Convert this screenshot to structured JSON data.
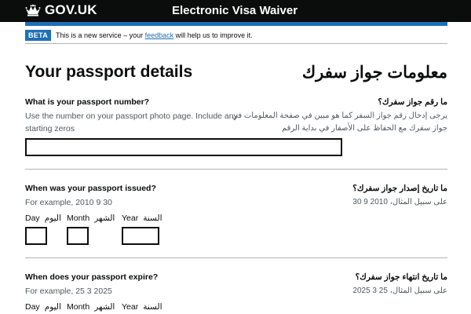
{
  "header": {
    "logo_text": "GOV.UK",
    "service_name": "Electronic Visa Waiver"
  },
  "phase_banner": {
    "tag": "BETA",
    "text_before": "This is a new service – your ",
    "link_text": "feedback",
    "text_after": " will help us to improve it."
  },
  "page": {
    "title_en": "Your passport details",
    "title_ar": "معلومات جواز سفرك"
  },
  "passport_number": {
    "label_en": "What is your passport number?",
    "label_ar": "ما رقم جواز سفرك؟",
    "hint_en_line1": "Use the number on your passport photo page. Include any",
    "hint_en_line2": "starting zeros",
    "hint_ar_line1": "يرجى إدخال رقم جواز السفر كما هو مبين في صفحة المعلومات في",
    "hint_ar_line2": "جواز سفرك مع الحفاظ على الأصفار في بداية الرقم",
    "value": ""
  },
  "issue_date": {
    "label_en": "When was your passport issued?",
    "label_ar": "ما تاريخ إصدار جواز سفرك؟",
    "hint_en": "For example, 2010 9 30",
    "hint_ar": "على سبيل المثال، 2010 9 30",
    "day_en": "Day",
    "day_ar": "اليوم",
    "month_en": "Month",
    "month_ar": "الشهر",
    "year_en": "Year",
    "year_ar": "السنة"
  },
  "expiry_date": {
    "label_en": "When does your passport expire?",
    "label_ar": "ما تاريخ انتهاء جواز سفرك؟",
    "hint_en": "For example, 25 3 2025",
    "hint_ar": "على سبيل المثال، 25 3 2025",
    "day_en": "Day",
    "day_ar": "اليوم",
    "month_en": "Month",
    "month_ar": "الشهر",
    "year_en": "Year",
    "year_ar": "السنة"
  },
  "icons": {
    "logo": "crown-icon"
  },
  "colors": {
    "header_bg": "#0b0c0c",
    "brand_blue": "#1d70b8",
    "text": "#0b0c0c",
    "hint": "#505a5f",
    "divider": "#b1b4b6"
  }
}
